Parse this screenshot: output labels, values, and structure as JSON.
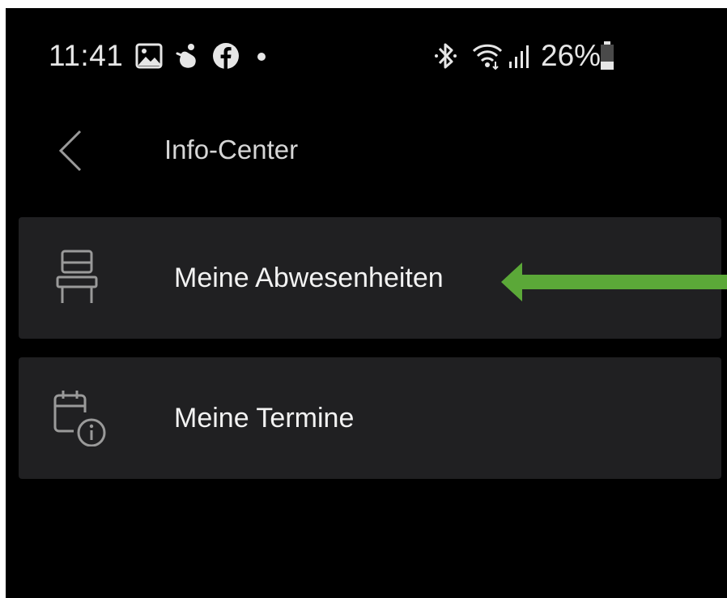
{
  "status_bar": {
    "time": "11:41",
    "notification_icons": [
      "image-icon",
      "hand-icon",
      "facebook-icon",
      "dot-icon"
    ],
    "system_icons": [
      "bluetooth-icon",
      "wifi-icon",
      "signal-icon",
      "battery-icon"
    ],
    "battery": "26%"
  },
  "header": {
    "title": "Info-Center",
    "back_icon": "chevron-left-icon"
  },
  "menu": {
    "items": [
      {
        "label": "Meine Abwesenheiten",
        "icon": "chair-icon"
      },
      {
        "label": "Meine Termine",
        "icon": "calendar-info-icon"
      }
    ]
  },
  "annotation": {
    "arrow_color": "#5ba838"
  },
  "colors": {
    "background": "#000000",
    "card": "#202022",
    "text": "#f2f2f2",
    "icon": "#9a9a9a"
  }
}
